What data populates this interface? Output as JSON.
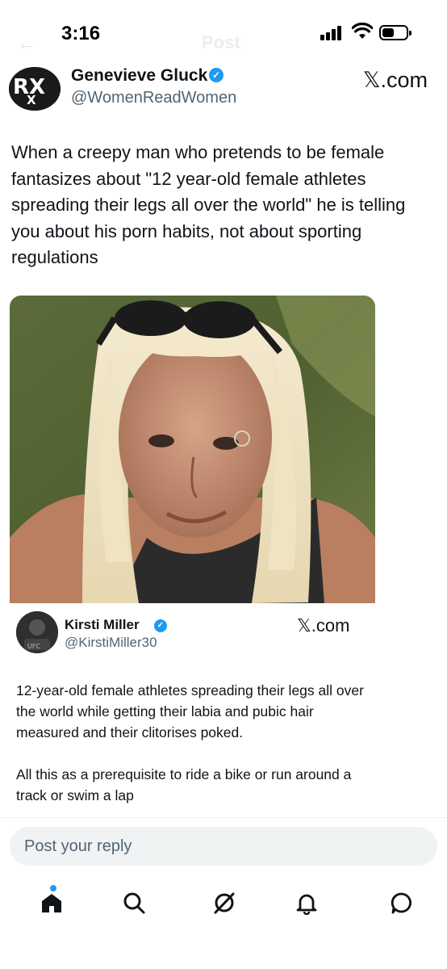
{
  "status_bar": {
    "time": "3:16",
    "battery_icon": "battery-icon",
    "wifi_icon": "wifi-icon",
    "signal_icon": "cellular-signal-icon"
  },
  "header": {
    "ghost_title": "Post",
    "ghost_back": "←"
  },
  "tweet": {
    "author_name": "Genevieve Gluck",
    "author_handle": "@WomenReadWomen",
    "avatar_text": "RXX",
    "source": "𝕏.com",
    "text": "When a creepy man who pretends to be female fantasizes about \"12 year-old female athletes spreading their legs all over the world\" he is telling you about his porn habits, not about sporting regulations"
  },
  "quote": {
    "author_name": "Kirsti Miller",
    "author_handle": "@KirstiMiller30",
    "source": "𝕏.com",
    "paragraph_1": "12-year-old female athletes spreading their legs all over the world while getting their labia and pubic hair measured and their clitorises poked.",
    "paragraph_2": "All this as a prerequisite to ride a bike or run around a track or swim a lap"
  },
  "reply": {
    "placeholder": "Post your reply"
  },
  "nav": {
    "items": [
      "home-icon",
      "search-icon",
      "grok-icon",
      "notifications-icon",
      "messages-icon"
    ]
  },
  "colors": {
    "accent": "#1d9bf0",
    "text": "#0f1419",
    "muted": "#536471",
    "input_bg": "#eff3f4"
  }
}
